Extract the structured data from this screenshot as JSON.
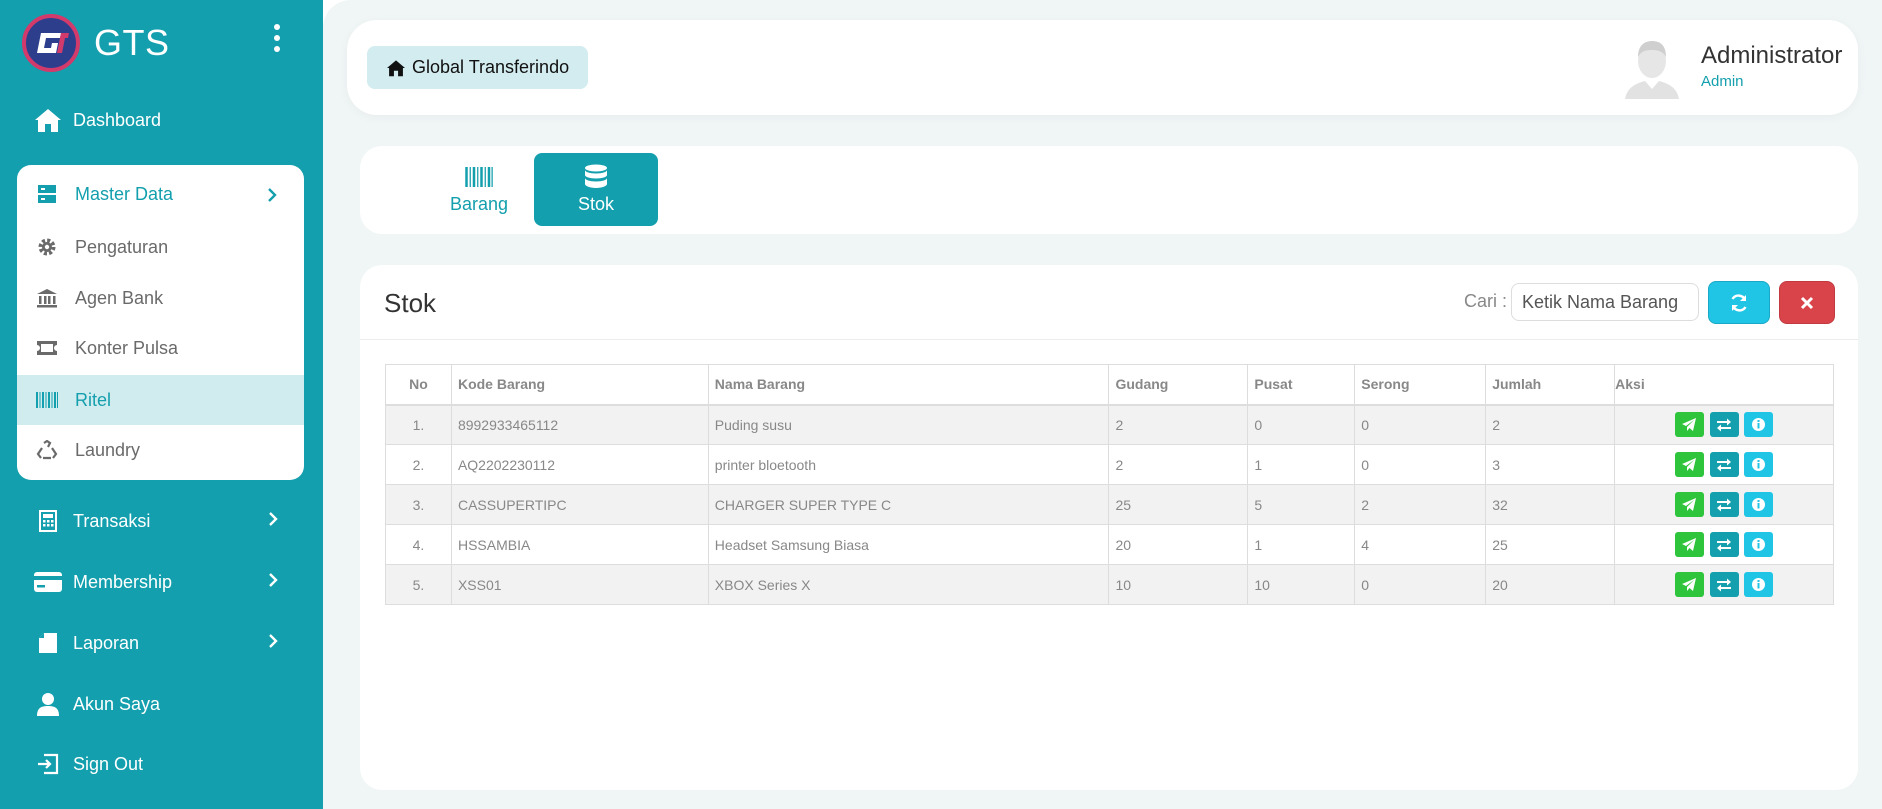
{
  "app": {
    "brand": "GTS",
    "colors": {
      "primary": "#139fad",
      "active_bg": "#d1ecef",
      "send": "#2ec43b",
      "info": "#20c5e6",
      "danger": "#d9434a"
    }
  },
  "sidebar": {
    "dashboard": {
      "label": "Dashboard",
      "icon": "home-icon"
    },
    "master": {
      "label": "Master Data",
      "icon": "server-icon",
      "items": [
        {
          "label": "Pengaturan",
          "icon": "gear-icon"
        },
        {
          "label": "Agen Bank",
          "icon": "bank-icon"
        },
        {
          "label": "Konter Pulsa",
          "icon": "ticket-icon"
        },
        {
          "label": "Ritel",
          "icon": "barcode-icon",
          "active": true
        },
        {
          "label": "Laundry",
          "icon": "recycle-icon"
        }
      ]
    },
    "transaksi": {
      "label": "Transaksi",
      "icon": "calculator-icon"
    },
    "membership": {
      "label": "Membership",
      "icon": "credit-card-icon"
    },
    "laporan": {
      "label": "Laporan",
      "icon": "file-icon"
    },
    "akun": {
      "label": "Akun Saya",
      "icon": "user-icon"
    },
    "signout": {
      "label": "Sign Out",
      "icon": "sign-out-icon"
    }
  },
  "topbar": {
    "home_label": "Global Transferindo",
    "user_name": "Administrator",
    "user_role": "Admin"
  },
  "tabs": [
    {
      "label": "Barang",
      "icon": "barcode-icon",
      "active": false
    },
    {
      "label": "Stok",
      "icon": "database-icon",
      "active": true
    }
  ],
  "stok": {
    "title": "Stok",
    "search_label": "Cari :",
    "search_placeholder": "Ketik Nama Barang",
    "columns": [
      "No",
      "Kode Barang",
      "Nama Barang",
      "Gudang",
      "Pusat",
      "Serong",
      "Jumlah",
      "Aksi"
    ],
    "rows": [
      [
        "1.",
        "8992933465112",
        "Puding susu",
        "2",
        "0",
        "0",
        "2"
      ],
      [
        "2.",
        "AQ2202230112",
        "printer bloetooth",
        "2",
        "1",
        "0",
        "3"
      ],
      [
        "3.",
        "CASSUPERTIPC",
        "CHARGER SUPER TYPE C",
        "25",
        "5",
        "2",
        "32"
      ],
      [
        "4.",
        "HSSAMBIA",
        "Headset Samsung Biasa",
        "20",
        "1",
        "4",
        "25"
      ],
      [
        "5.",
        "XSS01",
        "XBOX Series X",
        "10",
        "10",
        "0",
        "20"
      ]
    ]
  }
}
